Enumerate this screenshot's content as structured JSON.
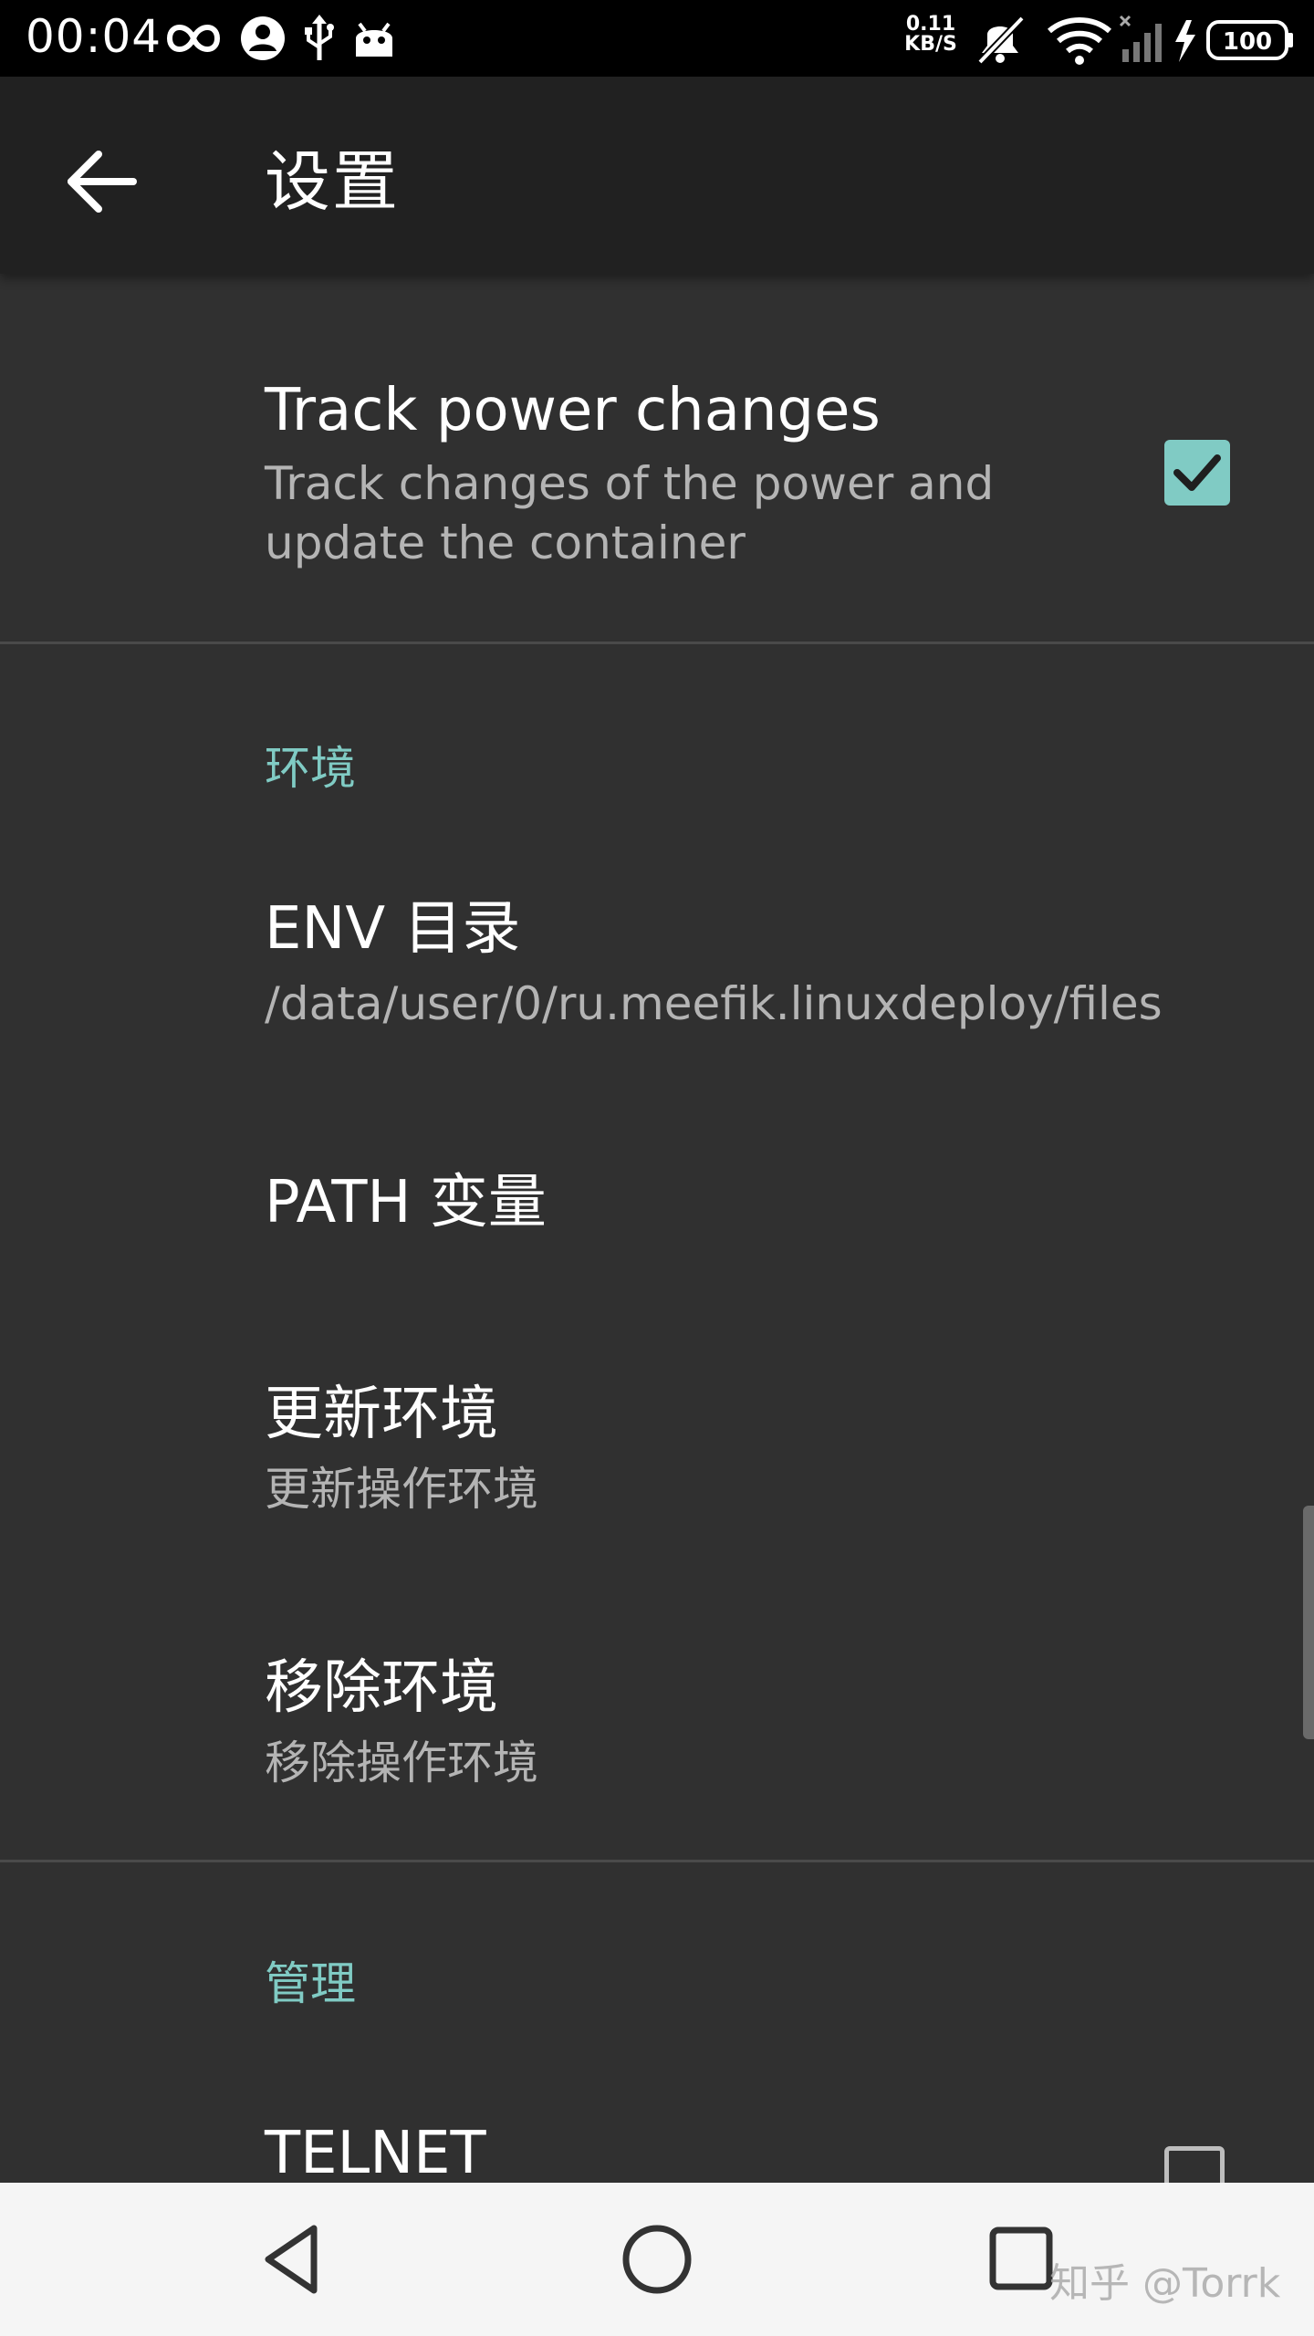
{
  "status_bar": {
    "time": "00:04",
    "net_speed_value": "0.11",
    "net_speed_unit": "KB/S",
    "battery": "100",
    "icons": [
      "infinity-icon",
      "account-icon",
      "usb-icon",
      "android-icon",
      "silent-icon",
      "wifi-icon",
      "no-signal-icon",
      "charging-icon",
      "battery-icon"
    ]
  },
  "app_bar": {
    "title": "设置",
    "back_icon": "arrow-left-icon"
  },
  "items": {
    "track_power": {
      "title": "Track power changes",
      "summary": "Track changes of the power and update the container",
      "checked": true
    },
    "env_section": "环境",
    "env_dir": {
      "title": "ENV 目录",
      "summary": "/data/user/0/ru.meefik.linuxdeploy/files"
    },
    "path_var": {
      "title": "PATH 变量"
    },
    "update_env": {
      "title": "更新环境",
      "summary": "更新操作环境"
    },
    "remove_env": {
      "title": "移除环境",
      "summary": "移除操作环境"
    },
    "manage_section": "管理",
    "telnet": {
      "title": "TELNET",
      "checked": false
    }
  },
  "nav_bar": {
    "back_icon": "triangle-back-icon",
    "home_icon": "circle-home-icon",
    "recents_icon": "square-recents-icon"
  },
  "watermark": "知乎 @Torrk",
  "colors": {
    "accent": "#80cbc4",
    "background": "#303030",
    "app_bar": "#212121",
    "nav_bar": "#f5f5f5"
  }
}
